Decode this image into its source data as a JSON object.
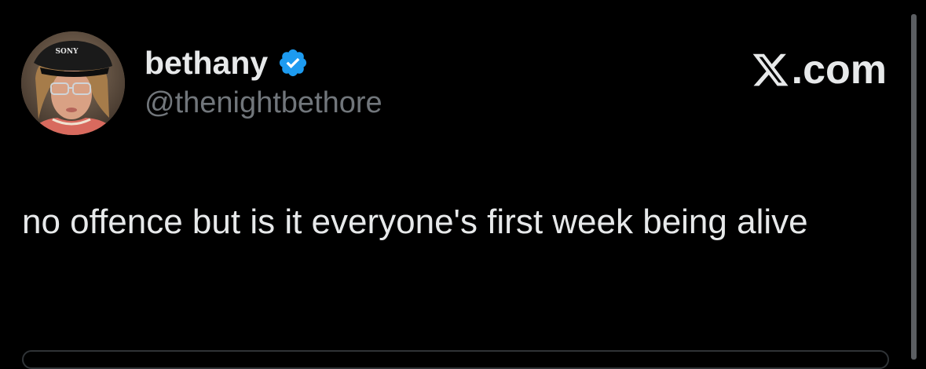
{
  "tweet": {
    "display_name": "bethany",
    "handle": "@thenightbethore",
    "text": "no offence but is it everyone's first week being alive",
    "verified_icon": "verified-badge-icon",
    "avatar_cap_text": "SONY"
  },
  "brand": {
    "logo_icon": "x-logo-icon",
    "suffix": ".com"
  },
  "colors": {
    "background": "#000000",
    "primary_text": "#e7e9ea",
    "secondary_text": "#71767b",
    "verified_blue": "#1d9bf0"
  }
}
